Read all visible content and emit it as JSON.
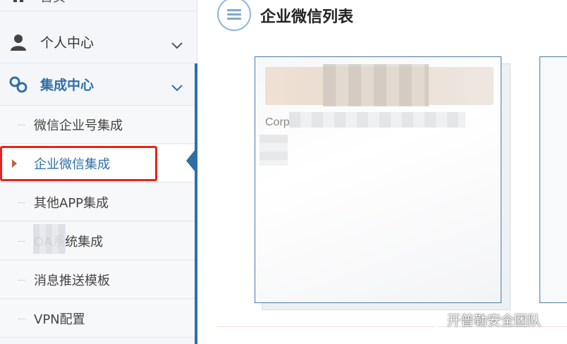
{
  "sidebar": {
    "home": {
      "label": "首页",
      "icon": "home-icon"
    },
    "personal": {
      "label": "个人中心",
      "icon": "user-icon"
    },
    "integration": {
      "label": "集成中心",
      "icon": "link-icon",
      "accent": "#2f6fa8",
      "items": [
        {
          "label": "微信企业号集成"
        },
        {
          "label": "企业微信集成"
        },
        {
          "label": "其他APP集成"
        },
        {
          "label": "OA系统集成"
        },
        {
          "label": "消息推送模板"
        },
        {
          "label": "VPN配置"
        }
      ],
      "active_index": 1
    }
  },
  "main": {
    "title": "企业微信列表",
    "menu_icon": "menu-icon",
    "card": {
      "label": "Corp"
    }
  },
  "watermark": {
    "text": "开普勒安全团队",
    "icon": "wechat-icon"
  },
  "colors": {
    "highlight": "#e8221c",
    "active_text": "#2f6fa8",
    "card_border": "#4a7aa5"
  }
}
